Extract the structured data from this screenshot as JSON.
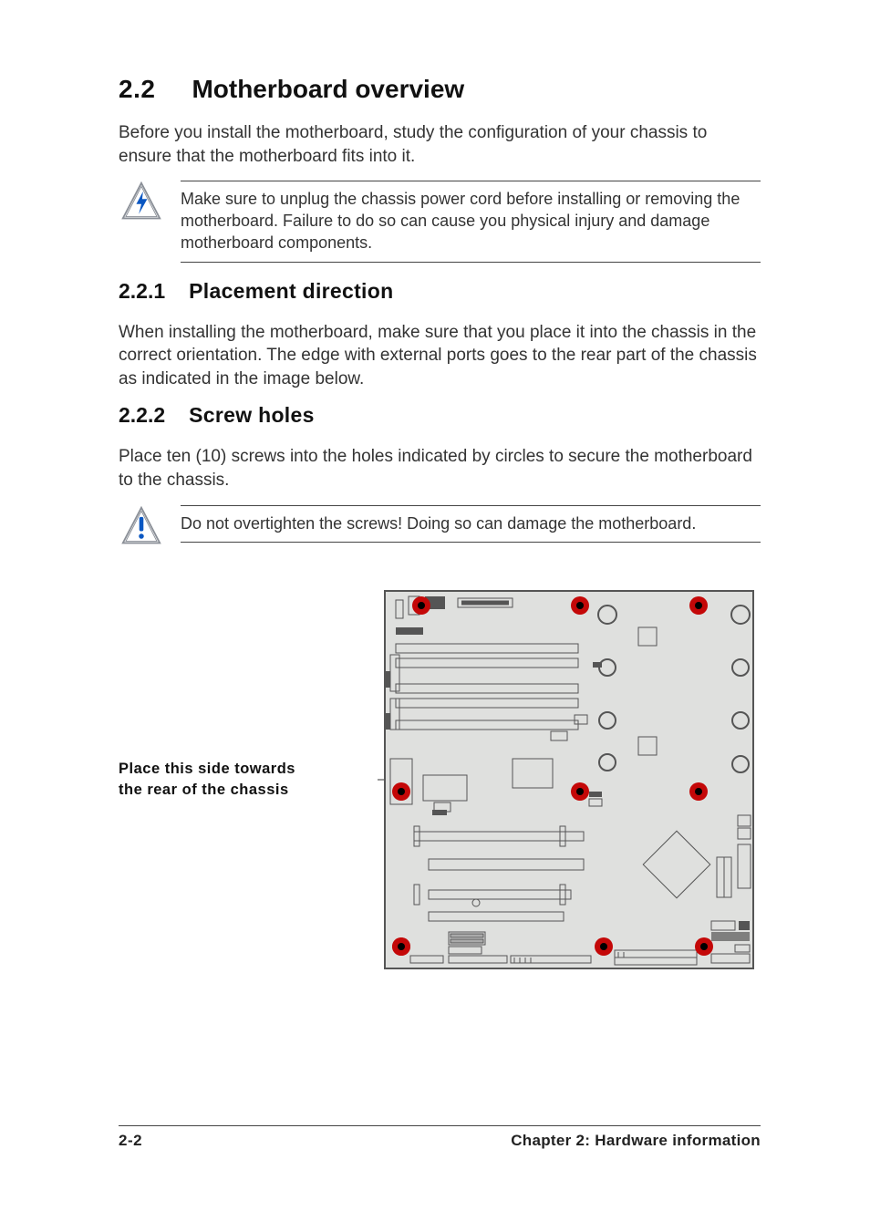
{
  "heading": {
    "number": "2.2",
    "title": "Motherboard overview"
  },
  "intro": "Before you install the motherboard, study the configuration of your chassis to ensure that the motherboard fits into it.",
  "warning1": "Make sure to unplug the chassis power cord before installing or removing the motherboard. Failure to do so can cause you physical injury and damage motherboard components.",
  "sections": [
    {
      "number": "2.2.1",
      "title": "Placement direction",
      "body": "When installing the motherboard, make sure that you place it into the chassis in the correct orientation. The edge with external ports goes to the rear part of the chassis as indicated in the image below."
    },
    {
      "number": "2.2.2",
      "title": "Screw holes",
      "body": "Place ten (10) screws into the holes indicated by circles to secure the motherboard to the chassis."
    }
  ],
  "warning2": "Do not overtighten the screws! Doing so can damage the motherboard.",
  "diagram_label_line1": "Place this side towards",
  "diagram_label_line2": "the rear of the chassis",
  "footer": {
    "left": "2-2",
    "right_chapter": "Chapter 2:",
    "right_title": "Hardware information"
  },
  "icons": {
    "lightning": "lightning-triangle-icon",
    "exclaim": "exclamation-triangle-icon"
  },
  "colors": {
    "screw_fill": "#c40808",
    "board_fill": "#dfe0de",
    "board_stroke": "#555"
  }
}
